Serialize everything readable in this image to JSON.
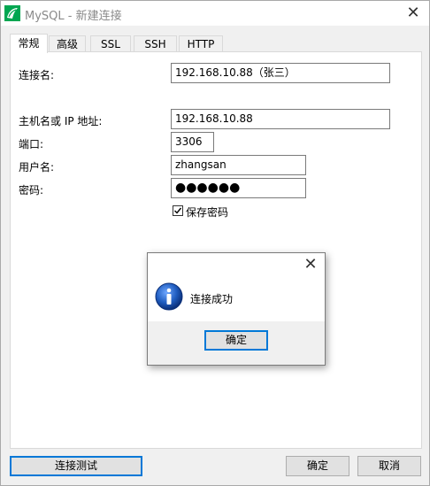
{
  "window": {
    "title": "MySQL - 新建连接",
    "close_glyph": "✕"
  },
  "tabs": [
    {
      "label": "常规",
      "active": true
    },
    {
      "label": "高级",
      "active": false
    },
    {
      "label": "SSL",
      "active": false
    },
    {
      "label": "SSH",
      "active": false
    },
    {
      "label": "HTTP",
      "active": false
    }
  ],
  "form": {
    "connection_name_label": "连接名:",
    "connection_name_value": "192.168.10.88（张三）",
    "host_label": "主机名或 IP 地址:",
    "host_value": "192.168.10.88",
    "port_label": "端口:",
    "port_value": "3306",
    "username_label": "用户名:",
    "username_value": "zhangsan",
    "password_label": "密码:",
    "password_mask": "●●●●●●",
    "save_password_label": "保存密码",
    "save_password_checked": true
  },
  "dialog": {
    "close_glyph": "✕",
    "message": "连接成功",
    "ok_label": "确定"
  },
  "footer": {
    "test_button": "连接测试",
    "ok_button": "确定",
    "cancel_button": "取消"
  },
  "colors": {
    "focus_border": "#0078d7",
    "app_icon_green": "#00a651",
    "info_icon_blue": "#1f5cbf"
  }
}
